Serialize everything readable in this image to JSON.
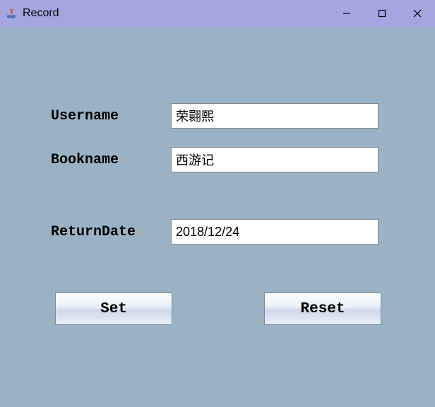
{
  "window": {
    "title": "Record"
  },
  "form": {
    "username_label": "Username",
    "username_value": "荣翾熙",
    "bookname_label": "Bookname",
    "bookname_value": "西游记",
    "returndate_label": "ReturnDate",
    "returndate_value": "2018/12/24"
  },
  "buttons": {
    "set_label": "Set",
    "reset_label": "Reset"
  }
}
